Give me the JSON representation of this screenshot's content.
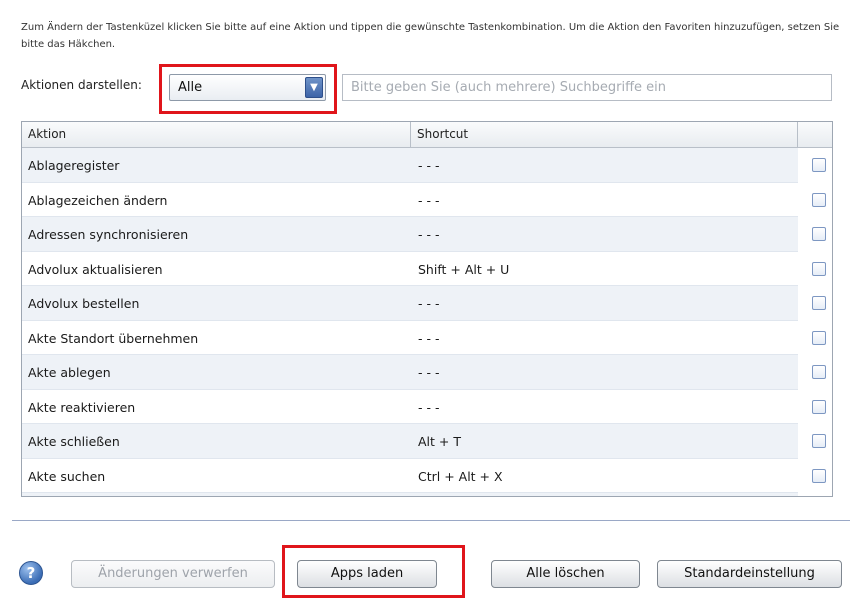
{
  "intro_text": "Zum Ändern der Tastenküzel klicken Sie bitte auf eine Aktion und tippen die gewünschte Tastenkombination. Um die Aktion den Favoriten hinzuzufügen, setzen Sie bitte das Häkchen.",
  "filter": {
    "label": "Aktionen darstellen:",
    "selected": "Alle",
    "arrow_icon": "dropdown-arrow-icon"
  },
  "search": {
    "placeholder": "Bitte geben Sie (auch mehrere) Suchbegriffe ein",
    "value": ""
  },
  "table": {
    "columns": [
      "Aktion",
      "Shortcut",
      ""
    ],
    "rows": [
      {
        "action": "Ablageregister",
        "shortcut": "- - -",
        "favorite": false
      },
      {
        "action": "Ablagezeichen ändern",
        "shortcut": "- - -",
        "favorite": false
      },
      {
        "action": "Adressen synchronisieren",
        "shortcut": "- - -",
        "favorite": false
      },
      {
        "action": "Advolux aktualisieren",
        "shortcut": "Shift + Alt + U",
        "favorite": false
      },
      {
        "action": "Advolux bestellen",
        "shortcut": "- - -",
        "favorite": false
      },
      {
        "action": "Akte Standort übernehmen",
        "shortcut": "- - -",
        "favorite": false
      },
      {
        "action": "Akte ablegen",
        "shortcut": "- - -",
        "favorite": false
      },
      {
        "action": "Akte reaktivieren",
        "shortcut": "- - -",
        "favorite": false
      },
      {
        "action": "Akte schließen",
        "shortcut": "Alt + T",
        "favorite": false
      },
      {
        "action": "Akte suchen",
        "shortcut": "Ctrl + Alt + X",
        "favorite": false
      }
    ]
  },
  "buttons": {
    "help": "?",
    "discard": "Änderungen verwerfen",
    "load_apps": "Apps laden",
    "clear_all": "Alle löschen",
    "defaults": "Standardeinstellung"
  },
  "colors": {
    "highlight": "#e0151b",
    "accent": "#3d64a8"
  }
}
